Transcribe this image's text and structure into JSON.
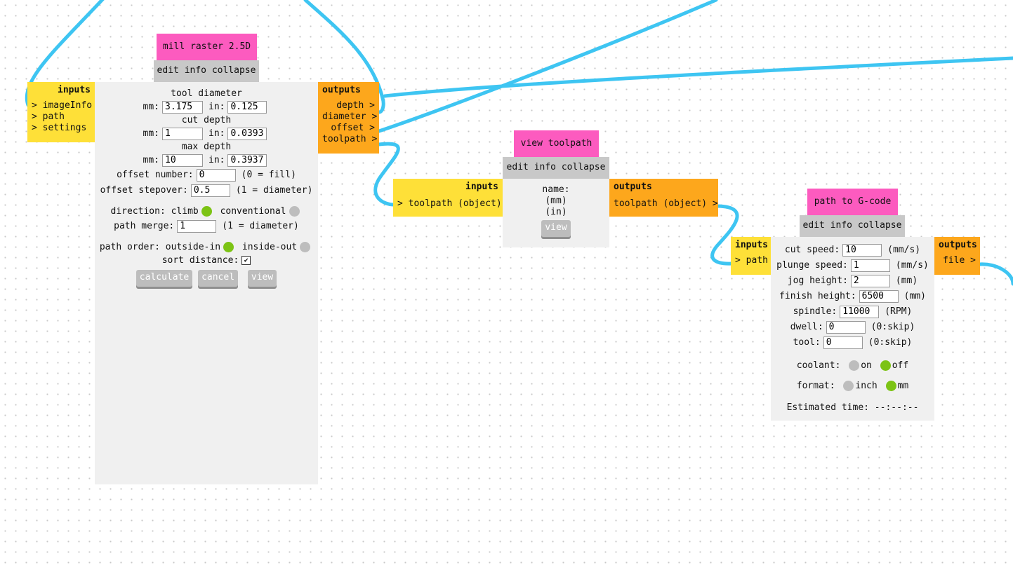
{
  "colors": {
    "wire": "#3ec5f2",
    "title": "#fc5bbf",
    "inputs": "#fee038",
    "outputs": "#fda71c",
    "panel": "#f0f0f0",
    "radio_on": "#7cc314",
    "radio_off": "#bdbdbd"
  },
  "node_tabs": {
    "edit": "edit",
    "info": "info",
    "collapse": "collapse"
  },
  "mill": {
    "title": "mill raster 2.5D",
    "inputs": {
      "head": "inputs",
      "ports": [
        "> imageInfo",
        "> path",
        "> settings"
      ]
    },
    "outputs": {
      "head": "outputs",
      "ports": [
        "depth >",
        "diameter >",
        "offset >",
        "toolpath >"
      ]
    },
    "tool_diameter": {
      "label": "tool diameter",
      "mm_label": "mm:",
      "mm": "3.175",
      "in_label": "in:",
      "in": "0.125"
    },
    "cut_depth": {
      "label": "cut depth",
      "mm_label": "mm:",
      "mm": "1",
      "in_label": "in:",
      "in": "0.03937"
    },
    "max_depth": {
      "label": "max depth",
      "mm_label": "mm:",
      "mm": "10",
      "in_label": "in:",
      "in": "0.39370"
    },
    "offset_number": {
      "label": "offset number:",
      "value": "0",
      "note": "(0 = fill)"
    },
    "offset_stepover": {
      "label": "offset stepover:",
      "value": "0.5",
      "note": "(1 = diameter)"
    },
    "direction": {
      "label": "direction:",
      "opt1": "climb",
      "opt2": "conventional",
      "selected": "climb"
    },
    "path_merge": {
      "label": "path merge:",
      "value": "1",
      "note": "(1 = diameter)"
    },
    "path_order": {
      "label": "path order:",
      "opt1": "outside-in",
      "opt2": "inside-out",
      "selected": "outside-in"
    },
    "sort_distance": {
      "label": "sort distance:",
      "checked": true
    },
    "buttons": {
      "calculate": "calculate",
      "cancel": "cancel",
      "view": "view"
    }
  },
  "view_toolpath": {
    "title": "view toolpath",
    "inputs": {
      "head": "inputs",
      "ports": [
        "> toolpath (object)"
      ]
    },
    "outputs": {
      "head": "outputs",
      "ports": [
        "toolpath (object) >"
      ]
    },
    "name_label": "name:",
    "mm_text": "(mm)",
    "in_text": "(in)",
    "view_button": "view"
  },
  "gcode": {
    "title": "path to G-code",
    "inputs": {
      "head": "inputs",
      "ports": [
        "> path"
      ]
    },
    "outputs": {
      "head": "outputs",
      "ports": [
        "file >"
      ]
    },
    "cut_speed": {
      "label": "cut speed:",
      "value": "10",
      "unit": "(mm/s)"
    },
    "plunge_speed": {
      "label": "plunge speed:",
      "value": "1",
      "unit": "(mm/s)"
    },
    "jog_height": {
      "label": "jog height:",
      "value": "2",
      "unit": "(mm)"
    },
    "finish_height": {
      "label": "finish height:",
      "value": "6500",
      "unit": "(mm)"
    },
    "spindle": {
      "label": "spindle:",
      "value": "11000",
      "unit": "(RPM)"
    },
    "dwell": {
      "label": "dwell:",
      "value": "0",
      "unit": "(0:skip)"
    },
    "tool": {
      "label": "tool:",
      "value": "0",
      "unit": "(0:skip)"
    },
    "coolant": {
      "label": "coolant:",
      "opt1": "on",
      "opt2": "off",
      "selected": "off"
    },
    "format": {
      "label": "format:",
      "opt1": "inch",
      "opt2": "mm",
      "selected": "mm"
    },
    "estimated": "Estimated time: --:--:--"
  }
}
